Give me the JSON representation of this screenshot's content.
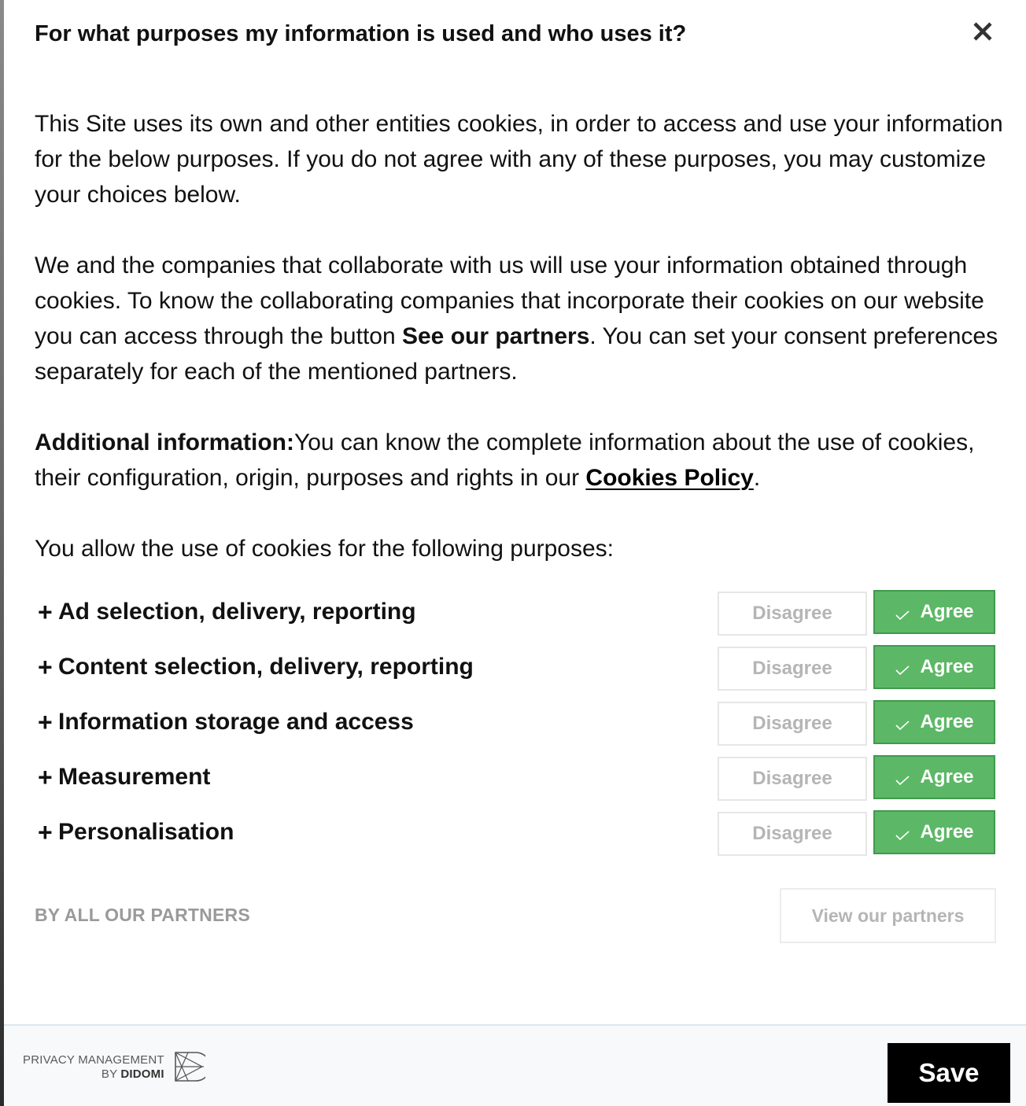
{
  "dialog": {
    "title": "For what purposes my information is used and who uses it?"
  },
  "intro": {
    "p1": "This Site uses its own and other entities cookies, in order to access and use your information for the below purposes. If you do not agree with any of these purposes, you may customize your choices below.",
    "p2_before": "We and the companies that collaborate with us will use your information obtained through cookies. To know the collaborating companies that incorporate their cookies on our website you can access through the button ",
    "p2_bold": "See our partners",
    "p2_after": ". You can set your consent preferences separately for each of the mentioned partners.",
    "p3_bold": "Additional information:",
    "p3_text": "You can know the complete information about the use of cookies, their configuration, origin, purposes and rights in our ",
    "p3_link": "Cookies Policy",
    "p3_end": ".",
    "p4": "You allow the use of cookies for the following purposes:"
  },
  "purposes": [
    {
      "label": "Ad selection, delivery, reporting",
      "disagree": "Disagree",
      "agree": "Agree"
    },
    {
      "label": "Content selection, delivery, reporting",
      "disagree": "Disagree",
      "agree": "Agree"
    },
    {
      "label": "Information storage and access",
      "disagree": "Disagree",
      "agree": "Agree"
    },
    {
      "label": "Measurement",
      "disagree": "Disagree",
      "agree": "Agree"
    },
    {
      "label": "Personalisation",
      "disagree": "Disagree",
      "agree": "Agree"
    }
  ],
  "expand_symbol": "+",
  "partners": {
    "heading": "BY ALL OUR PARTNERS",
    "button": "View our partners"
  },
  "footer": {
    "brand_line1": "PRIVACY MANAGEMENT",
    "brand_by": "BY ",
    "brand_name": "DIDOMI",
    "save": "Save"
  },
  "colors": {
    "agree_bg": "#5cb866",
    "agree_border": "#3f9a4c",
    "disabled_text": "#b5b5b5",
    "save_bg": "#000000"
  },
  "icons": {
    "close": "close-icon",
    "check": "check-icon",
    "brand": "didomi-logo-icon"
  }
}
